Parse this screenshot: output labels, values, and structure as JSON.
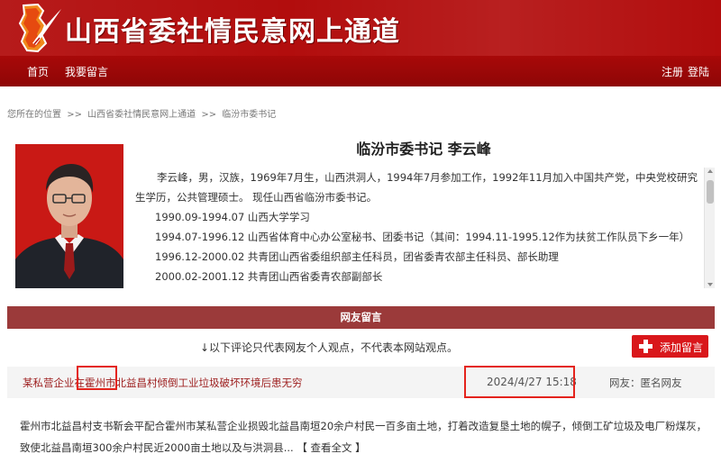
{
  "site": {
    "title": "山西省委社情民意网上通道"
  },
  "nav": {
    "home": "首页",
    "my_messages": "我要留言",
    "register": "注册",
    "login": "登陆"
  },
  "breadcrumb": {
    "prefix": "您所在的位置",
    "sep1": ">>",
    "crumb1": "山西省委社情民意网上通道",
    "sep2": ">>",
    "crumb2": "临汾市委书记"
  },
  "profile": {
    "title": "临汾市委书记 李云峰",
    "bio_intro": "李云峰，男，汉族，1969年7月生，山西洪洞人，1994年7月参加工作，1992年11月加入中国共产党，中央党校研究生学历，公共管理硕士。 现任山西省临汾市委书记。",
    "bio_lines": [
      "1990.09-1994.07 山西大学学习",
      "1994.07-1996.12 山西省体育中心办公室秘书、团委书记（其间：1994.11-1995.12作为扶贫工作队员下乡一年）",
      "1996.12-2000.02 共青团山西省委组织部主任科员，团省委青农部主任科员、部长助理",
      "2000.02-2001.12 共青团山西省委青农部副部长"
    ]
  },
  "comments": {
    "section_title": "网友留言",
    "disclaimer": "↓以下评论只代表网友个人观点，不代表本网站观点。",
    "add_button": "添加留言",
    "items": [
      {
        "title": "某私营企业在霍州市北益昌村倾倒工业垃圾破坏环境后患无穷",
        "date": "2024/4/27 15:18",
        "author": "网友：匿名网友",
        "body": "霍州市北益昌村支书靳会平配合霍州市某私营企业损毁北益昌南垣20余户村民一百多亩土地，打着改造复垦土地的幌子，倾倒工矿垃圾及电厂粉煤灰，致使北益昌南垣300余户村民近2000亩土地以及与洪洞县... 【",
        "more": "查看全文",
        "close": "】"
      }
    ]
  },
  "colors": {
    "header_red": "#b20d0d",
    "nav_red": "#9a0707",
    "section_bar": "#9b3a3a",
    "button_red": "#d9171b",
    "highlight_box": "#e4231c",
    "title_link": "#9d1e1e"
  },
  "icons": {
    "logo": "shanxi-map-with-quill-logo",
    "add": "plus-icon"
  }
}
